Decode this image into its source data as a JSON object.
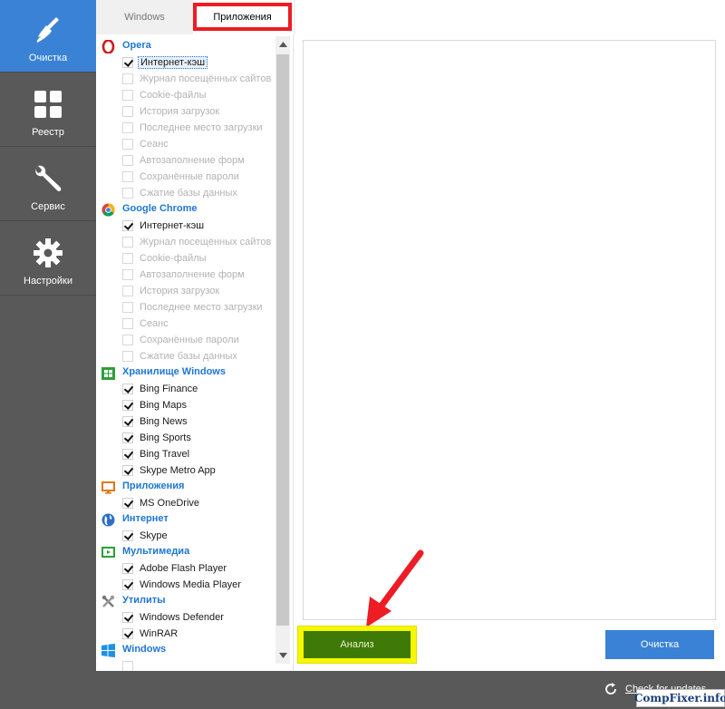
{
  "sidebar": {
    "items": [
      {
        "label": "Очистка",
        "icon": "broom-icon",
        "active": true
      },
      {
        "label": "Реестр",
        "icon": "grid-icon",
        "active": false
      },
      {
        "label": "Сервис",
        "icon": "wrench-icon",
        "active": false
      },
      {
        "label": "Настройки",
        "icon": "gear-icon",
        "active": false
      }
    ]
  },
  "tabs": {
    "windows": "Windows",
    "apps": "Приложения"
  },
  "groups": [
    {
      "title": "Opera",
      "icon": "opera-icon",
      "items": [
        {
          "label": "Интернет-кэш",
          "checked": true,
          "selected": true
        },
        {
          "label": "Журнал посещённых сайтов",
          "checked": false
        },
        {
          "label": "Cookie-файлы",
          "checked": false
        },
        {
          "label": "История загрузок",
          "checked": false
        },
        {
          "label": "Последнее место загрузки",
          "checked": false
        },
        {
          "label": "Сеанс",
          "checked": false
        },
        {
          "label": "Автозаполнение форм",
          "checked": false
        },
        {
          "label": "Сохранённые пароли",
          "checked": false
        },
        {
          "label": "Сжатие базы данных",
          "checked": false
        }
      ]
    },
    {
      "title": "Google Chrome",
      "icon": "chrome-icon",
      "items": [
        {
          "label": "Интернет-кэш",
          "checked": true
        },
        {
          "label": "Журнал посещённых сайтов",
          "checked": false
        },
        {
          "label": "Cookie-файлы",
          "checked": false
        },
        {
          "label": "Автозаполнение форм",
          "checked": false
        },
        {
          "label": "История загрузок",
          "checked": false
        },
        {
          "label": "Последнее место загрузки",
          "checked": false
        },
        {
          "label": "Сеанс",
          "checked": false
        },
        {
          "label": "Сохранённые пароли",
          "checked": false
        },
        {
          "label": "Сжатие базы данных",
          "checked": false
        }
      ]
    },
    {
      "title": "Хранилище Windows",
      "icon": "windows-store-icon",
      "items": [
        {
          "label": "Bing Finance",
          "checked": true
        },
        {
          "label": "Bing Maps",
          "checked": true
        },
        {
          "label": "Bing News",
          "checked": true
        },
        {
          "label": "Bing Sports",
          "checked": true
        },
        {
          "label": "Bing Travel",
          "checked": true
        },
        {
          "label": "Skype Metro App",
          "checked": true
        }
      ]
    },
    {
      "title": "Приложения",
      "icon": "monitor-icon",
      "items": [
        {
          "label": "MS OneDrive",
          "checked": true
        }
      ]
    },
    {
      "title": "Интернет",
      "icon": "globe-icon",
      "items": [
        {
          "label": "Skype",
          "checked": true
        }
      ]
    },
    {
      "title": "Мультимедиа",
      "icon": "media-icon",
      "items": [
        {
          "label": "Adobe Flash Player",
          "checked": true
        },
        {
          "label": "Windows Media Player",
          "checked": true
        }
      ]
    },
    {
      "title": "Утилиты",
      "icon": "tools-icon",
      "items": [
        {
          "label": "Windows Defender",
          "checked": true
        },
        {
          "label": "WinRAR",
          "checked": true
        }
      ]
    },
    {
      "title": "Windows",
      "icon": "windows-logo-icon",
      "items": [
        {
          "label": "",
          "checked": false
        }
      ]
    }
  ],
  "buttons": {
    "analyze": "Анализ",
    "clean": "Очистка"
  },
  "footer": {
    "update_link": "Check for updates",
    "watermark": "CompFixer.info"
  },
  "colors": {
    "accent": "#3a82d6",
    "sidebar": "#595959",
    "analyze": "#3f7a08",
    "highlight_yellow": "#f7f700",
    "highlight_red": "#ee1c24",
    "group_title": "#1e76d2"
  }
}
